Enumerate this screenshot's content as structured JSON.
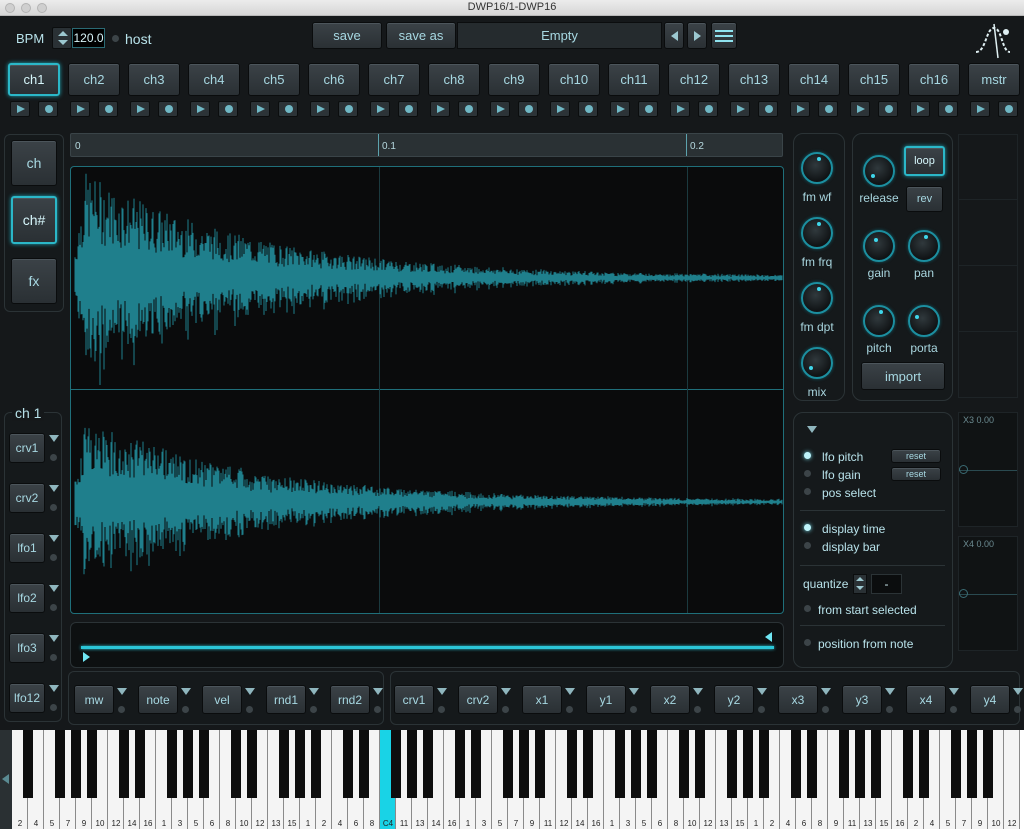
{
  "window": {
    "title": "DWP16/1-DWP16"
  },
  "header": {
    "bpm_label": "BPM",
    "bpm_value": "120.0",
    "host_label": "host",
    "save_label": "save",
    "save_as_label": "save as",
    "preset_name": "Empty"
  },
  "channels": [
    "ch1",
    "ch2",
    "ch3",
    "ch4",
    "ch5",
    "ch6",
    "ch7",
    "ch8",
    "ch9",
    "ch10",
    "ch11",
    "ch12",
    "ch13",
    "ch14",
    "ch15",
    "ch16",
    "mstr"
  ],
  "side_tabs": [
    "ch",
    "ch#",
    "fx"
  ],
  "timeline": {
    "ticks": [
      "0",
      "0.1",
      "0.2"
    ]
  },
  "fm_knobs": [
    "fm wf",
    "fm frq",
    "fm dpt",
    "mix"
  ],
  "sample": {
    "release_label": "release",
    "loop_label": "loop",
    "rev_label": "rev",
    "gain_label": "gain",
    "pan_label": "pan",
    "pitch_label": "pitch",
    "porta_label": "porta",
    "import_label": "import"
  },
  "mod_panel": {
    "title": "ch 1",
    "items": [
      "crv1",
      "crv2",
      "lfo1",
      "lfo2",
      "lfo3",
      "lfo12"
    ]
  },
  "options": {
    "lfo_pitch": "lfo pitch",
    "lfo_gain": "lfo gain",
    "reset": "reset",
    "pos_select": "pos select",
    "display_time": "display time",
    "display_bar": "display bar",
    "quantize": "quantize",
    "quantize_value": "-",
    "from_start": "from start selected",
    "position_from_note": "position from note"
  },
  "xy": {
    "x3": "X3 0.00",
    "x4": "X4 0.00"
  },
  "sources_left": [
    "mw",
    "note",
    "vel",
    "rnd1",
    "rnd2"
  ],
  "sources_right": [
    "crv1",
    "crv2",
    "x1",
    "y1",
    "x2",
    "y2",
    "x3",
    "y3",
    "x4",
    "y4"
  ],
  "keyboard": {
    "labels": [
      "2",
      "4",
      "5",
      "7",
      "9",
      "10",
      "12",
      "14",
      "16",
      "1",
      "3",
      "5",
      "6",
      "8",
      "10",
      "12",
      "13",
      "15",
      "1",
      "2",
      "4",
      "6",
      "8",
      "C4",
      "11",
      "13",
      "14",
      "16",
      "1",
      "3",
      "5",
      "7",
      "9",
      "11",
      "12",
      "14",
      "16",
      "1",
      "3",
      "5",
      "6",
      "8",
      "10",
      "12",
      "13",
      "15",
      "1",
      "2",
      "4",
      "6",
      "8",
      "9",
      "11",
      "13",
      "15",
      "16",
      "2",
      "4",
      "5",
      "7",
      "9",
      "10",
      "12"
    ],
    "highlight_index": 23
  },
  "colors": {
    "accent": "#2bb7c8",
    "wave": "#1f7f8c",
    "key_highlight": "#19d3e6"
  }
}
